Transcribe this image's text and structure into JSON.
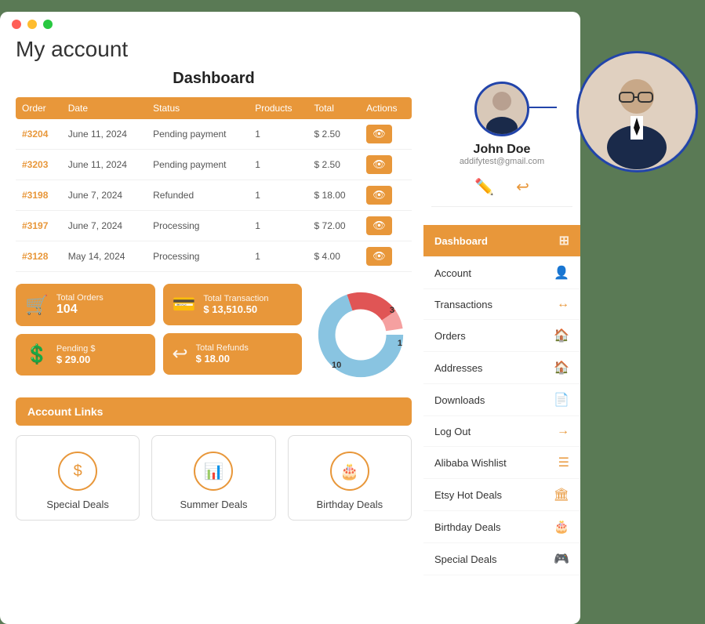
{
  "window": {
    "title": "My account"
  },
  "dashboard": {
    "title": "Dashboard",
    "table": {
      "headers": [
        "Order",
        "Date",
        "Status",
        "Products",
        "Total",
        "Actions"
      ],
      "rows": [
        {
          "order": "#3204",
          "date": "June 11, 2024",
          "status": "Pending payment",
          "products": "1",
          "total": "$ 2.50"
        },
        {
          "order": "#3203",
          "date": "June 11, 2024",
          "status": "Pending payment",
          "products": "1",
          "total": "$ 2.50"
        },
        {
          "order": "#3198",
          "date": "June 7, 2024",
          "status": "Refunded",
          "products": "1",
          "total": "$ 18.00"
        },
        {
          "order": "#3197",
          "date": "June 7, 2024",
          "status": "Processing",
          "products": "1",
          "total": "$ 72.00"
        },
        {
          "order": "#3128",
          "date": "May 14, 2024",
          "status": "Processing",
          "products": "1",
          "total": "$ 4.00"
        }
      ]
    },
    "stats": {
      "total_orders_label": "Total Orders",
      "total_orders_value": "104",
      "total_transaction_label": "Total Transaction",
      "total_transaction_value": "$ 13,510.50",
      "pending_label": "Pending $",
      "pending_value": "$ 29.00",
      "total_refunds_label": "Total Refunds",
      "total_refunds_value": "$ 18.00"
    },
    "donut": {
      "label_3": "3",
      "label_1": "1",
      "label_10": "10"
    }
  },
  "account_links": {
    "header": "Account Links",
    "deals": [
      {
        "label": "Special Deals",
        "icon": "$"
      },
      {
        "label": "Summer Deals",
        "icon": "📊"
      },
      {
        "label": "Birthday Deals",
        "icon": "🎂"
      }
    ]
  },
  "profile": {
    "name": "John Doe",
    "email": "addifytest@gmail.com"
  },
  "sidebar": {
    "items": [
      {
        "label": "Dashboard",
        "icon": "⊞",
        "active": true
      },
      {
        "label": "Account",
        "icon": "👤",
        "active": false
      },
      {
        "label": "Transactions",
        "icon": "↔",
        "active": false
      },
      {
        "label": "Orders",
        "icon": "🏠",
        "active": false
      },
      {
        "label": "Addresses",
        "icon": "🏠",
        "active": false
      },
      {
        "label": "Downloads",
        "icon": "📄",
        "active": false
      },
      {
        "label": "Log Out",
        "icon": "→",
        "active": false
      },
      {
        "label": "Alibaba Wishlist",
        "icon": "☰",
        "active": false
      },
      {
        "label": "Etsy Hot Deals",
        "icon": "🏛",
        "active": false
      },
      {
        "label": "Birthday Deals",
        "icon": "🎂",
        "active": false
      },
      {
        "label": "Special Deals",
        "icon": "🎮",
        "active": false
      }
    ]
  }
}
